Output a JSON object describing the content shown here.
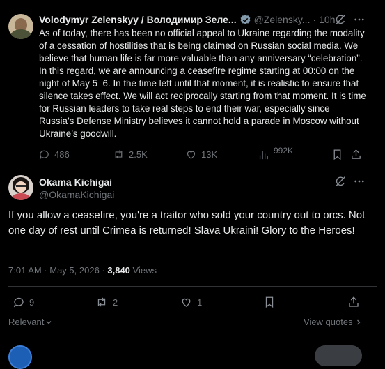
{
  "quoted_post": {
    "author_name": "Volodymyr Zelenskyy / Володимир Зеле...",
    "handle": "@Zelensky...",
    "separator": "·",
    "time": "10h",
    "text": "As of today, there has been no official appeal to Ukraine regarding the modality of a cessation of hostilities that is being claimed on Russian social media. We believe that human life is far more valuable than any anniversary “celebration”. In this regard, we are announcing a ceasefire regime starting at 00:00 on the night of May 5–6. In the time left until that moment, it is realistic to ensure that silence takes effect. We will act reciprocally starting from that moment. It is time for Russian leaders to take real steps to end their war, especially since Russia’s Defense Ministry believes it cannot hold a parade in Moscow without Ukraine’s goodwill.",
    "actions": {
      "replies": "486",
      "reposts": "2.5K",
      "likes": "13K",
      "views": "992K"
    }
  },
  "main_post": {
    "author_name": "Okama Kichigai",
    "handle": "@OkamaKichigai",
    "text": "If you allow a ceasefire, you're a traitor who sold your country out to orcs. Not one day of rest until Crimea is returned! Slava Ukraini! Glory to the Heroes!",
    "time": "7:01 AM · May 5, 2026 · ",
    "views_count": "3,840",
    "views_label": " Views",
    "actions": {
      "replies": "9",
      "reposts": "2",
      "likes": "1"
    }
  },
  "footer": {
    "sort_label": "Relevant",
    "view_quotes": "View quotes"
  },
  "colors": {
    "background": "#000000",
    "text": "#e7e9ea",
    "muted": "#71767b",
    "verified": "#829aab"
  }
}
